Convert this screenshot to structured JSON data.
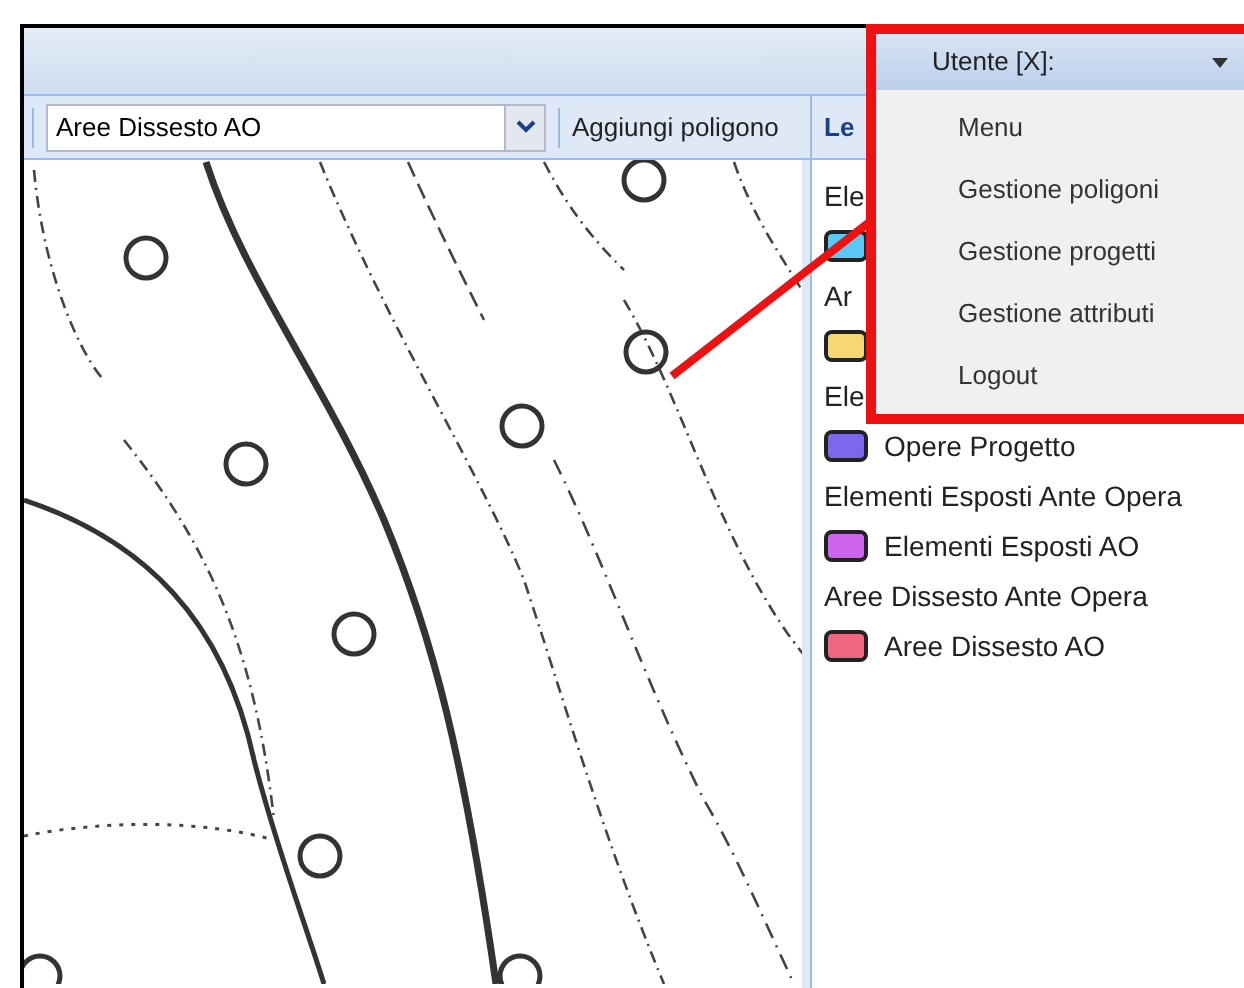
{
  "toolbar": {
    "layer_select": {
      "value": "Aree Dissesto AO"
    },
    "add_button": "Aggiungi poligono"
  },
  "legend": {
    "title": "Le",
    "items": [
      {
        "kind": "group",
        "label": "Ele"
      },
      {
        "kind": "layer",
        "color": "#5bc8f5"
      },
      {
        "kind": "group",
        "label": "Ar"
      },
      {
        "kind": "layer",
        "color": "#f7d774"
      },
      {
        "kind": "group",
        "label": "Ele"
      },
      {
        "kind": "layer",
        "label": "Opere Progetto",
        "color": "#7b68ee"
      },
      {
        "kind": "group",
        "label": "Elementi Esposti Ante Opera"
      },
      {
        "kind": "layer",
        "label": "Elementi Esposti AO",
        "color": "#cc66ee"
      },
      {
        "kind": "group",
        "label": "Aree Dissesto Ante Opera"
      },
      {
        "kind": "layer",
        "label": "Aree Dissesto AO",
        "color": "#ee6680"
      }
    ]
  },
  "user_menu": {
    "label": "Utente [X]:",
    "items": [
      "Menu",
      "Gestione poligoni",
      "Gestione progetti",
      "Gestione attributi",
      "Logout"
    ]
  }
}
